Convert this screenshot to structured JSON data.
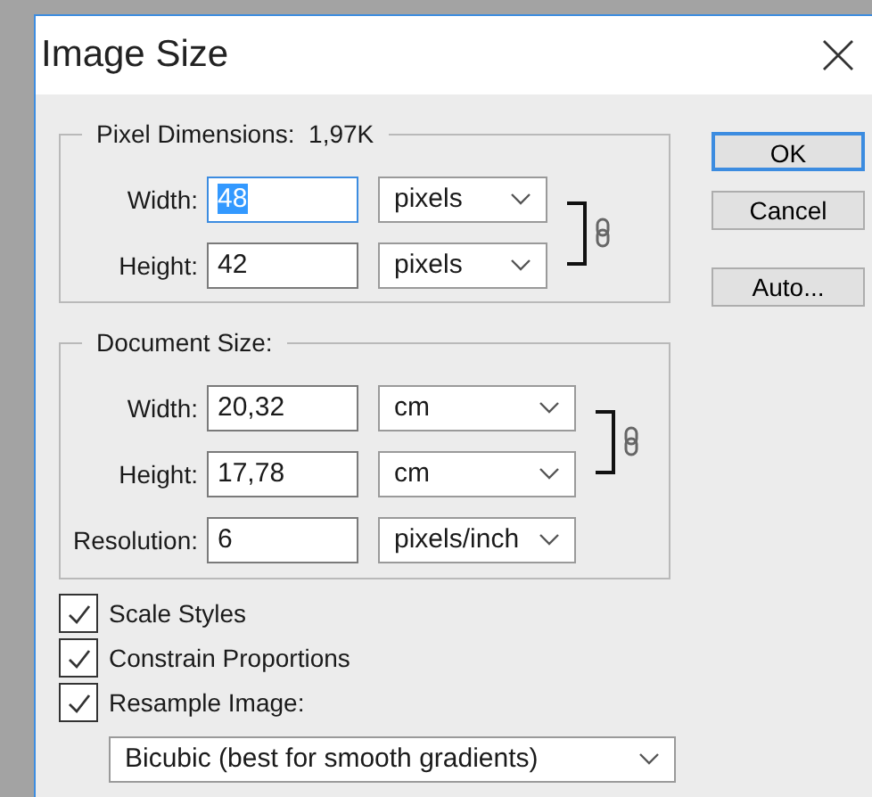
{
  "window": {
    "title": "Image Size"
  },
  "pixel_dimensions": {
    "label": "Pixel Dimensions:",
    "value": "1,97K",
    "rows": [
      {
        "label": "Width:",
        "value": "48",
        "focused": true,
        "unit": "pixels",
        "linked": true
      },
      {
        "label": "Height:",
        "value": "42",
        "focused": false,
        "unit": "pixels",
        "linked": true
      }
    ]
  },
  "document_size": {
    "label": "Document Size:",
    "rows": [
      {
        "label": "Width:",
        "value": "20,32",
        "focused": false,
        "unit": "cm",
        "linked": true
      },
      {
        "label": "Height:",
        "value": "17,78",
        "focused": false,
        "unit": "cm",
        "linked": true
      },
      {
        "label": "Resolution:",
        "value": "6",
        "focused": false,
        "unit": "pixels/inch",
        "linked": false
      }
    ]
  },
  "options": [
    {
      "label": "Scale Styles",
      "checked": true
    },
    {
      "label": "Constrain Proportions",
      "checked": true
    },
    {
      "label": "Resample Image:",
      "checked": true
    }
  ],
  "resample_method": "Bicubic (best for smooth gradients)",
  "buttons": [
    {
      "label": "OK",
      "default": true
    },
    {
      "label": "Cancel",
      "default": false
    },
    {
      "label": "Auto...",
      "default": false
    }
  ]
}
